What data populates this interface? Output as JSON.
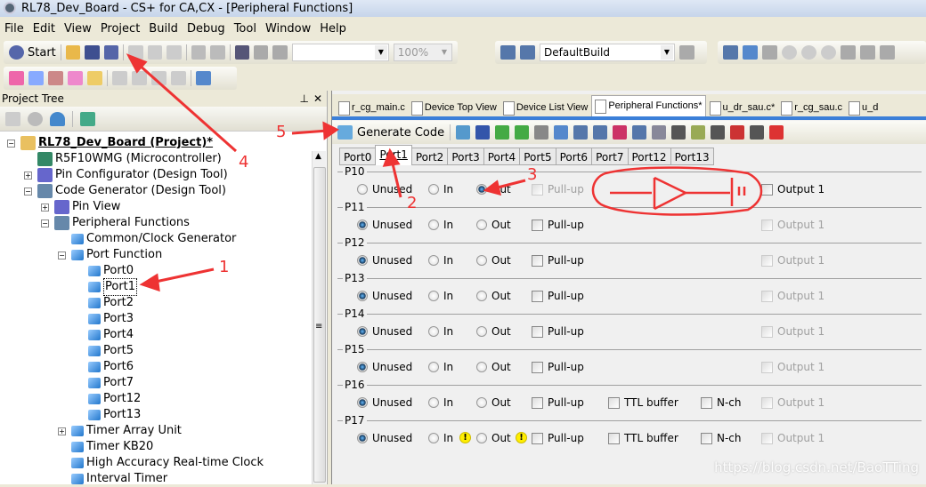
{
  "window": {
    "title": "RL78_Dev_Board - CS+ for CA,CX - [Peripheral Functions]"
  },
  "menu": [
    "File",
    "Edit",
    "View",
    "Project",
    "Build",
    "Debug",
    "Tool",
    "Window",
    "Help"
  ],
  "toolbar": {
    "start_label": "Start",
    "zoom_value": "100%",
    "build_config": "DefaultBuild",
    "search_value": ""
  },
  "project_tree": {
    "title": "Project Tree",
    "items": [
      {
        "label": "RL78_Dev_Board (Project)*",
        "level": 0,
        "toggle": "-",
        "icon": "project-icon",
        "bold": true
      },
      {
        "label": "R5F10WMG (Microcontroller)",
        "level": 1,
        "toggle": "",
        "icon": "chip-icon"
      },
      {
        "label": "Pin Configurator (Design Tool)",
        "level": 1,
        "toggle": "+",
        "icon": "pin-icon"
      },
      {
        "label": "Code Generator (Design Tool)",
        "level": 1,
        "toggle": "-",
        "icon": "code-generator-icon"
      },
      {
        "label": "Pin View",
        "level": 2,
        "toggle": "+",
        "icon": "pin-icon"
      },
      {
        "label": "Peripheral Functions",
        "level": 2,
        "toggle": "-",
        "icon": "code-generator-icon"
      },
      {
        "label": "Common/Clock Generator",
        "level": 3,
        "toggle": "",
        "icon": "cube-icon"
      },
      {
        "label": "Port Function",
        "level": 3,
        "toggle": "-",
        "icon": "cube-icon"
      },
      {
        "label": "Port0",
        "level": 4,
        "toggle": "",
        "icon": "cube-icon"
      },
      {
        "label": "Port1",
        "level": 4,
        "toggle": "",
        "icon": "cube-icon",
        "selected": true
      },
      {
        "label": "Port2",
        "level": 4,
        "toggle": "",
        "icon": "cube-icon"
      },
      {
        "label": "Port3",
        "level": 4,
        "toggle": "",
        "icon": "cube-icon"
      },
      {
        "label": "Port4",
        "level": 4,
        "toggle": "",
        "icon": "cube-icon"
      },
      {
        "label": "Port5",
        "level": 4,
        "toggle": "",
        "icon": "cube-icon"
      },
      {
        "label": "Port6",
        "level": 4,
        "toggle": "",
        "icon": "cube-icon"
      },
      {
        "label": "Port7",
        "level": 4,
        "toggle": "",
        "icon": "cube-icon"
      },
      {
        "label": "Port12",
        "level": 4,
        "toggle": "",
        "icon": "cube-icon"
      },
      {
        "label": "Port13",
        "level": 4,
        "toggle": "",
        "icon": "cube-icon"
      },
      {
        "label": "Timer Array Unit",
        "level": 3,
        "toggle": "+",
        "icon": "cube-icon"
      },
      {
        "label": "Timer KB20",
        "level": 3,
        "toggle": "",
        "icon": "cube-icon"
      },
      {
        "label": "High Accuracy Real-time Clock",
        "level": 3,
        "toggle": "",
        "icon": "cube-icon"
      },
      {
        "label": "Interval Timer",
        "level": 3,
        "toggle": "",
        "icon": "cube-icon"
      }
    ]
  },
  "doc_tabs": [
    {
      "label": "r_cg_main.c"
    },
    {
      "label": "Device Top View"
    },
    {
      "label": "Device List View"
    },
    {
      "label": "Peripheral Functions*",
      "active": true
    },
    {
      "label": "u_dr_sau.c*"
    },
    {
      "label": "r_cg_sau.c"
    },
    {
      "label": "u_d"
    }
  ],
  "generate_code_label": "Generate Code",
  "port_tabs": [
    {
      "label": "Port0"
    },
    {
      "label": "Port1",
      "active": true
    },
    {
      "label": "Port2"
    },
    {
      "label": "Port3"
    },
    {
      "label": "Port4"
    },
    {
      "label": "Port5"
    },
    {
      "label": "Port6"
    },
    {
      "label": "Port7"
    },
    {
      "label": "Port12"
    },
    {
      "label": "Port13"
    }
  ],
  "labels": {
    "unused": "Unused",
    "in": "In",
    "out": "Out",
    "pullup": "Pull-up",
    "ttl": "TTL buffer",
    "nch": "N-ch",
    "output1": "Output 1"
  },
  "pins": [
    {
      "name": "P10",
      "mode": "Out",
      "pullup_enabled": false,
      "output1_enabled": true,
      "ttl": false,
      "nch": false,
      "warnings": false
    },
    {
      "name": "P11",
      "mode": "Unused",
      "pullup_enabled": true,
      "output1_enabled": false,
      "ttl": false,
      "nch": false,
      "warnings": false
    },
    {
      "name": "P12",
      "mode": "Unused",
      "pullup_enabled": true,
      "output1_enabled": false,
      "ttl": false,
      "nch": false,
      "warnings": false
    },
    {
      "name": "P13",
      "mode": "Unused",
      "pullup_enabled": true,
      "output1_enabled": false,
      "ttl": false,
      "nch": false,
      "warnings": false
    },
    {
      "name": "P14",
      "mode": "Unused",
      "pullup_enabled": true,
      "output1_enabled": false,
      "ttl": false,
      "nch": false,
      "warnings": false
    },
    {
      "name": "P15",
      "mode": "Unused",
      "pullup_enabled": true,
      "output1_enabled": false,
      "ttl": false,
      "nch": false,
      "warnings": false
    },
    {
      "name": "P16",
      "mode": "Unused",
      "pullup_enabled": true,
      "output1_enabled": false,
      "ttl": true,
      "nch": true,
      "warnings": false
    },
    {
      "name": "P17",
      "mode": "Unused",
      "pullup_enabled": true,
      "output1_enabled": false,
      "ttl": true,
      "nch": true,
      "warnings": true
    }
  ],
  "annotations": [
    "1",
    "2",
    "3",
    "4",
    "5"
  ],
  "watermark": "https://blog.csdn.net/BaoTTing",
  "colors": {
    "annotation": "#ee3333",
    "accent": "#3b7fd8"
  }
}
